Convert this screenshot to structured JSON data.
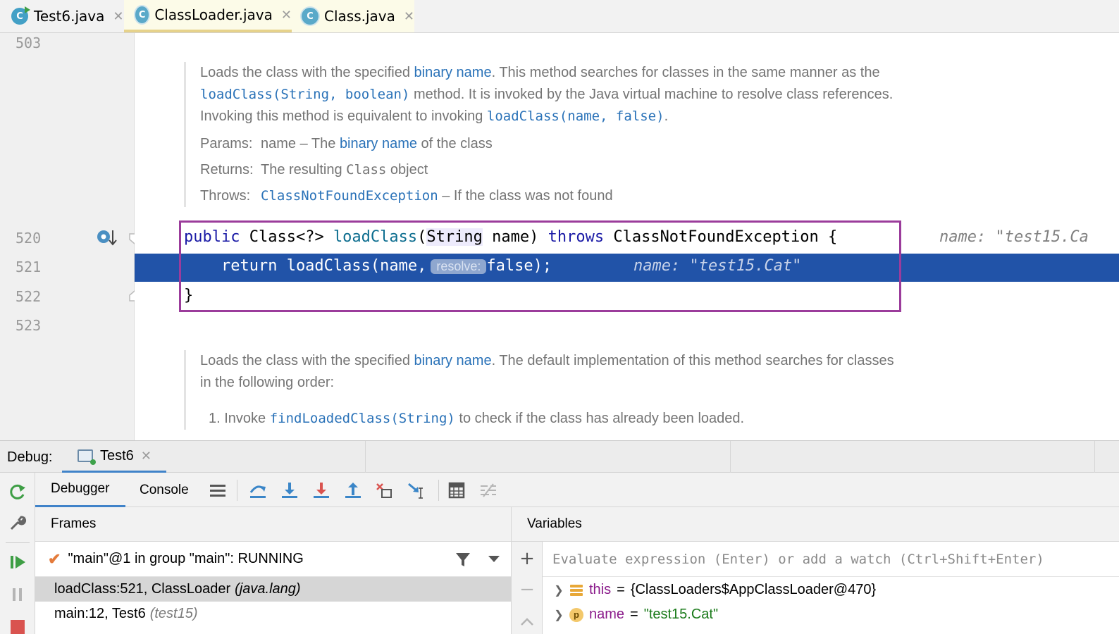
{
  "tabs": [
    {
      "label": "Test6.java",
      "icon": "java-class-run-icon",
      "close": "✕"
    },
    {
      "label": "ClassLoader.java",
      "icon": "java-class-library-icon",
      "close": "✕"
    },
    {
      "label": "Class.java",
      "icon": "java-class-library-icon",
      "close": "✕"
    }
  ],
  "icon_letter": "C",
  "gutter": {
    "lines": [
      "503",
      "520",
      "521",
      "522",
      "523"
    ]
  },
  "doc1": {
    "l1_a": "Loads the class with the specified ",
    "l1_link": "binary name",
    "l1_b": ". This method searches for classes in the same manner as the",
    "l2_code": "loadClass(String, boolean)",
    "l2_b": " method. It is invoked by the Java virtual machine to resolve class references.",
    "l3_a": "Invoking this method is equivalent to invoking ",
    "l3_code": "loadClass(name, false)",
    "l3_b": ".",
    "params_label": "Params:",
    "params_a": "name – The ",
    "params_link": "binary name",
    "params_b": " of the class",
    "returns_label": "Returns:",
    "returns_a": "The resulting ",
    "returns_code": "Class",
    "returns_b": " object",
    "throws_label": "Throws:",
    "throws_code": "ClassNotFoundException",
    "throws_b": " – If the class was not found"
  },
  "code": {
    "l520_kw1": "public",
    "l520_a": " Class<?> ",
    "l520_fn": "loadClass",
    "l520_b": "(",
    "l520_type": "String",
    "l520_c": " name) ",
    "l520_kw2": "throws",
    "l520_d": " ClassNotFoundException {",
    "l520_hint": "name: \"test15.Ca",
    "l521_a": "    return loadClass(name,",
    "l521_inlay": "resolve:",
    "l521_b": "false);",
    "l521_hint": "name: \"test15.Cat\"",
    "l522": "}"
  },
  "doc2": {
    "l1_a": "Loads the class with the specified ",
    "l1_link": "binary name",
    "l1_b": ". The default implementation of this method searches for classes",
    "l2": "in the following order:",
    "item_num": "1.",
    "item_a": "Invoke ",
    "item_code": "findLoadedClass(String)",
    "item_b": " to check if the class has already been loaded."
  },
  "debug": {
    "title": "Debug:",
    "session_tab": "Test6",
    "session_close": "✕",
    "tabs": [
      "Debugger",
      "Console"
    ],
    "frames_header": "Frames",
    "variables_header": "Variables",
    "thread": "\"main\"@1 in group \"main\": RUNNING",
    "frames": [
      {
        "method": "loadClass:521, ClassLoader",
        "pkg": "(java.lang)"
      },
      {
        "method": "main:12, Test6",
        "pkg": "(test15)"
      }
    ],
    "eval_placeholder": "Evaluate expression (Enter) or add a watch (Ctrl+Shift+Enter)",
    "variables": [
      {
        "name": "this",
        "eq": "=",
        "value": "{ClassLoaders$AppClassLoader@470}",
        "icon": "field-icon"
      },
      {
        "name": "name",
        "eq": "=",
        "value": "\"test15.Cat\"",
        "icon": "parameter-icon",
        "icon_letter": "p"
      }
    ]
  },
  "colors": {
    "exec_line": "#2153a8",
    "frame_box": "#9b3c9b",
    "link": "#2a72b8",
    "keyword": "#1a1aa6"
  }
}
